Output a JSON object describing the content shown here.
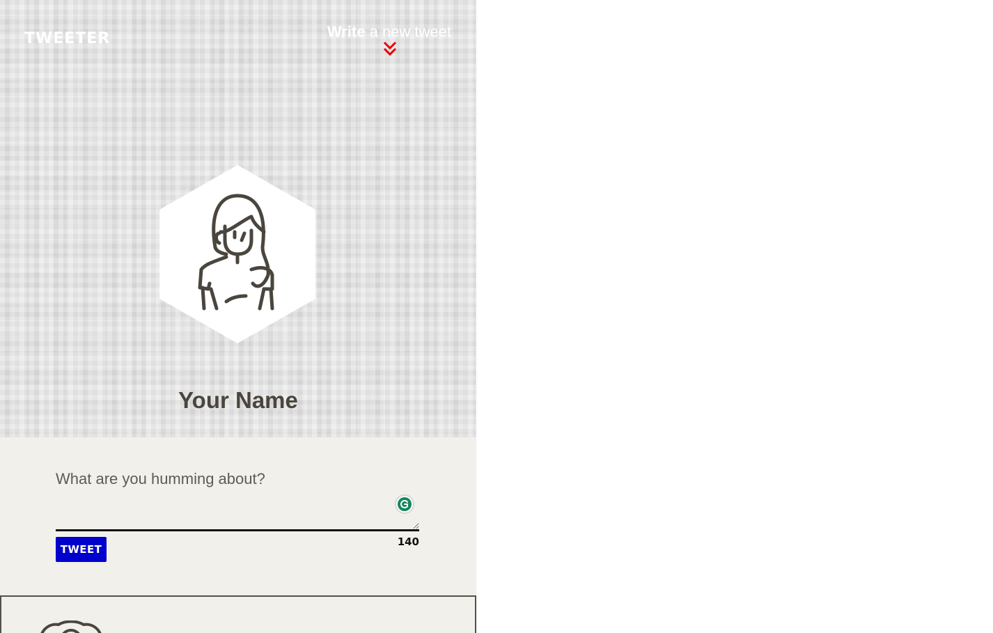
{
  "app": {
    "logo": "TWEETER"
  },
  "header": {
    "compose_toggle": {
      "strong": "Write",
      "rest": " a new tweet"
    },
    "profile_name": "Your Name"
  },
  "composer": {
    "placeholder": "What are you humming about?",
    "char_count": "140",
    "submit_label": "TWEET"
  },
  "colors": {
    "accent_blue": "#0000cc",
    "chevron_red": "#e60000",
    "grammarly_green": "#15875f"
  },
  "icons": {
    "compose": "double-chevron-down-icon",
    "avatar": "woman-avatar-icon",
    "grammarly": "grammarly-icon"
  }
}
